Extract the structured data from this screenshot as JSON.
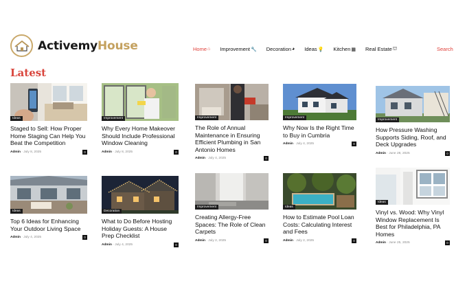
{
  "brand": {
    "part1": "Activemy",
    "part2": "House"
  },
  "nav": [
    {
      "label": "Home",
      "icon": "home-icon",
      "glyph": "⌂"
    },
    {
      "label": "Improvement",
      "icon": "wrench-icon",
      "glyph": "🔧"
    },
    {
      "label": "Decoration",
      "icon": "paint-icon",
      "glyph": "◕"
    },
    {
      "label": "Ideas",
      "icon": "bulb-icon",
      "glyph": "💡"
    },
    {
      "label": "Kitchen",
      "icon": "kitchen-icon",
      "glyph": "▦"
    },
    {
      "label": "Real Estate",
      "icon": "buildings-icon",
      "glyph": "⛫"
    }
  ],
  "search_label": "Search",
  "section_title": "Latest",
  "cards": [
    {
      "category": "Ideas",
      "title": "Staged to Sell: How Proper Home Staging Can Help You Beat the Competition",
      "author": "Admin",
      "date": "July 8, 2025",
      "comments": "0"
    },
    {
      "category": "Improvement",
      "title": "Why Every Home Makeover Should Include Professional Window Cleaning",
      "author": "Admin",
      "date": "July 8, 2025",
      "comments": "0"
    },
    {
      "category": "Improvement",
      "title": "The Role of Annual Maintenance in Ensuring Efficient Plumbing in San Antonio Homes",
      "author": "Admin",
      "date": "July 4, 2025",
      "comments": "0"
    },
    {
      "category": "Improvement",
      "title": "Why Now Is the Right Time to Buy in Cumbria",
      "author": "Admin",
      "date": "July 4, 2025",
      "comments": "0"
    },
    {
      "category": "Improvement",
      "title": "How Pressure Washing Supports Siding, Roof, and Deck Upgrades",
      "author": "Admin",
      "date": "June 28, 2025",
      "comments": "0"
    },
    {
      "category": "Ideas",
      "title": "Top 6 Ideas for Enhancing Your Outdoor Living Space",
      "author": "Admin",
      "date": "July 4, 2025",
      "comments": "0"
    },
    {
      "category": "Decoration",
      "title": "What to Do Before Hosting Holiday Guests: A House Prep Checklist",
      "author": "Admin",
      "date": "July 4, 2025",
      "comments": "0"
    },
    {
      "category": "Improvement",
      "title": "Creating Allergy-Free Spaces: The Role of Clean Carpets",
      "author": "Admin",
      "date": "July 2, 2025",
      "comments": "0"
    },
    {
      "category": "Ideas",
      "title": "How to Estimate Pool Loan Costs: Calculating Interest and Fees",
      "author": "Admin",
      "date": "July 2, 2025",
      "comments": "0"
    },
    {
      "category": "Ideas",
      "title": "Vinyl vs. Wood: Why Vinyl Window Replacement Is Best for Philadelphia, PA Homes",
      "author": "Admin",
      "date": "June 25, 2025",
      "comments": "0"
    }
  ]
}
